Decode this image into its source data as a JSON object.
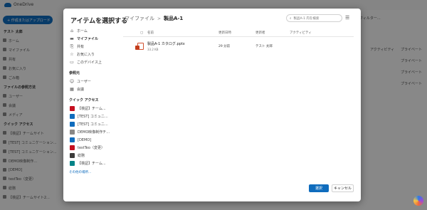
{
  "background": {
    "app_name": "OneDrive",
    "new_button": "+ 作成またはアップロード",
    "sidebar": [
      {
        "type": "section",
        "label": "テスト 太郎"
      },
      {
        "type": "item",
        "label": "ホーム"
      },
      {
        "type": "item",
        "label": "マイファイル"
      },
      {
        "type": "item",
        "label": "共有"
      },
      {
        "type": "item",
        "label": "お気に入り"
      },
      {
        "type": "item",
        "label": "ごみ箱"
      },
      {
        "type": "section",
        "label": "ファイルの参照方法"
      },
      {
        "type": "item",
        "label": "ユーザー"
      },
      {
        "type": "item",
        "label": "会議"
      },
      {
        "type": "item",
        "label": "メディア"
      },
      {
        "type": "section",
        "label": "クイック アクセス"
      },
      {
        "type": "item",
        "label": "【検証】チームサイト"
      },
      {
        "type": "item",
        "label": "[TEST] コミュニケーション..."
      },
      {
        "type": "item",
        "label": "[TEST] コミュニケーション..."
      },
      {
        "type": "item",
        "label": "DEMO映像制作..."
      },
      {
        "type": "item",
        "label": "[DEMO]"
      },
      {
        "type": "item",
        "label": "testTeo（変更）"
      },
      {
        "type": "item",
        "label": "総務"
      },
      {
        "type": "item",
        "label": "【検証】チームサイト2..."
      }
    ],
    "top_right": "フィルター...",
    "column_header": "アクティビティ",
    "column_values": [
      "プライベート",
      "プライベート",
      "プライベート",
      "プライベート"
    ]
  },
  "dialog": {
    "title": "アイテムを選択する",
    "nav": [
      {
        "label": "ホーム",
        "icon": "home-icon",
        "glyph": "⌂"
      },
      {
        "label": "マイファイル",
        "icon": "folder-icon",
        "glyph": "▬",
        "active": true
      },
      {
        "label": "共有",
        "icon": "shared-icon",
        "glyph": "⎘"
      },
      {
        "label": "お気に入り",
        "icon": "star-icon",
        "glyph": "☆"
      },
      {
        "label": "このデバイス上",
        "icon": "device-icon",
        "glyph": "▭"
      }
    ],
    "browse_section": "参照元",
    "browse": [
      {
        "label": "ユーザー",
        "icon": "people-icon",
        "glyph": "☺"
      },
      {
        "label": "会議",
        "icon": "calendar-icon",
        "glyph": "▦"
      }
    ],
    "quick_access_section": "クイック アクセス",
    "quick_access": [
      {
        "label": "【検証】チーム...",
        "color": "#c50f1f"
      },
      {
        "label": "[TEST] コミュニ...",
        "color": "#0f6cbd"
      },
      {
        "label": "[TEST] コミュニ...",
        "color": "#0f6cbd"
      },
      {
        "label": "DEMO映像制作チ...",
        "color": "#8a8886"
      },
      {
        "label": "[DEMO]",
        "color": "#0f6cbd"
      },
      {
        "label": "testTeo（変更）",
        "color": "#c50f1f"
      },
      {
        "label": "総務",
        "color": "#3b3a39"
      },
      {
        "label": "【検証】チーム...",
        "color": "#038387"
      }
    ],
    "more_places": "その他の場所...",
    "breadcrumb": {
      "parent": "マイファイル",
      "separator": ">",
      "current": "製品A-1"
    },
    "search_placeholder": "製品A-1 内を検索",
    "columns": {
      "name": "名前",
      "modified": "更新日時",
      "modified_by": "更新者",
      "activity": "アクティビティ"
    },
    "files": [
      {
        "name": "製品A-1 カタログ.pptx",
        "size": "33.2 KB",
        "modified": "29 分前",
        "modified_by": "テスト 太郎",
        "activity": ""
      }
    ],
    "buttons": {
      "primary": "選択",
      "secondary": "キャンセル"
    }
  },
  "colors": {
    "accent": "#0f6cbd",
    "overlay": "rgba(0,0,0,0.45)"
  }
}
